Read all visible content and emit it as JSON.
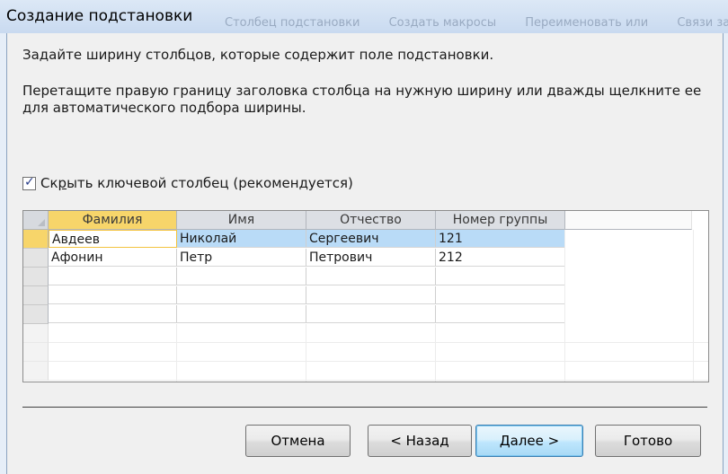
{
  "window": {
    "title": "Создание подстановки",
    "ghost_text": [
      "Столбец подстановки",
      "Создать макросы",
      "Переименовать или",
      "Связи зависимостей"
    ]
  },
  "wizard": {
    "instruction": "Задайте ширину столбцов, которые содержит поле подстановки.",
    "hint": "Перетащите правую границу заголовка столбца на нужную ширину или дважды щелкните ее для автоматического подбора ширины.",
    "hide_key": {
      "label_before": "Ск",
      "label_underlined": "р",
      "label_after": "ыть ключевой столбец (рекомендуется)",
      "checked": true
    }
  },
  "grid": {
    "columns": [
      "Фамилия",
      "Имя",
      "Отчество",
      "Номер группы"
    ],
    "rows": [
      [
        "Авдеев",
        "Николай",
        "Сергеевич",
        "121"
      ],
      [
        "Афонин",
        "Петр",
        "Петрович",
        "212"
      ]
    ],
    "empty_rows": 3,
    "active_column": 0,
    "active_row": 0
  },
  "buttons": {
    "cancel": "Отмена",
    "back": "< Назад",
    "next": "Далее >",
    "finish": "Готово"
  },
  "colors": {
    "active_header": "#f7d56a",
    "selected_row": "#b9dbf7",
    "default_button_border": "#3c7fb1"
  }
}
